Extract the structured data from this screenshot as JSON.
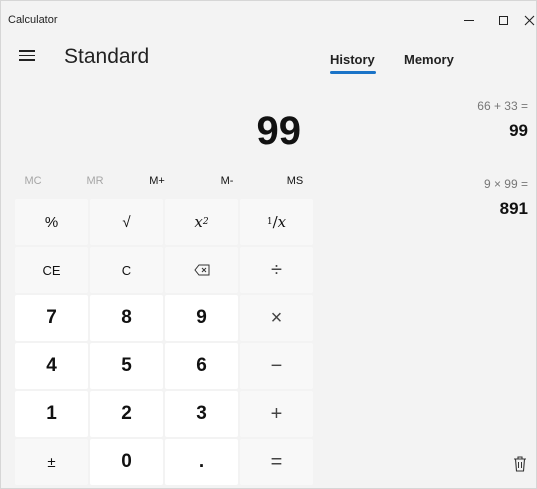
{
  "window": {
    "title": "Calculator"
  },
  "header": {
    "mode": "Standard"
  },
  "display": {
    "value": "99"
  },
  "memory_row": [
    "MC",
    "MR",
    "M+",
    "M-",
    "MS"
  ],
  "keys": {
    "percent": "%",
    "sqrt": "√",
    "square": "x",
    "square_sup": "2",
    "reciprocal_num": "1",
    "reciprocal_den": "x",
    "ce": "CE",
    "c": "C",
    "divide": "÷",
    "multiply": "×",
    "minus": "−",
    "plus": "+",
    "equals": "=",
    "negate": "±",
    "decimal": ".",
    "d0": "0",
    "d1": "1",
    "d2": "2",
    "d3": "3",
    "d4": "4",
    "d5": "5",
    "d6": "6",
    "d7": "7",
    "d8": "8",
    "d9": "9"
  },
  "panel": {
    "tabs": [
      "History",
      "Memory"
    ],
    "history": [
      {
        "expression": "66  +  33 =",
        "result": "99"
      },
      {
        "expression": "9  ×  99 =",
        "result": "891"
      }
    ]
  }
}
